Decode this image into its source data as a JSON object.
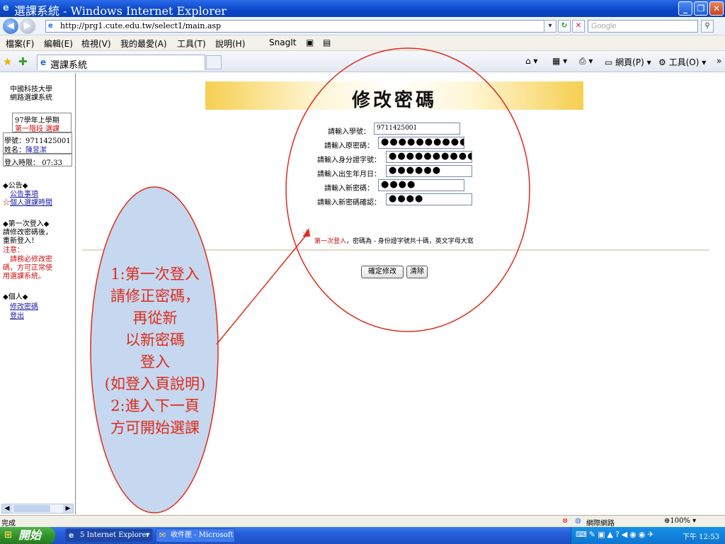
{
  "window": {
    "title": "選課系統 - Windows Internet Explorer",
    "minimize": "_",
    "maximize": "❐",
    "close": "✕"
  },
  "address": {
    "url": "http://prg1.cute.edu.tw/select1/main.asp",
    "search_placeholder": "Google"
  },
  "menu": {
    "items": [
      "檔案(F)",
      "編輯(E)",
      "檢視(V)",
      "我的最愛(A)",
      "工具(T)",
      "說明(H)"
    ],
    "snagit": "SnagIt"
  },
  "tabs": {
    "active_tab": "選課系統",
    "page_menu": "網頁(P)",
    "tools_menu": "工具(O)"
  },
  "sidebar": {
    "school": "中國科技大學",
    "system": "網路選課系統",
    "semester": "97學年上學期",
    "stage": "第一階段 選課",
    "student_id_label": "學號：",
    "student_id": "9711425001",
    "name_label": "姓名：",
    "name": "陳昱潔",
    "login_label": "登入時限：",
    "login_time": "07:33",
    "announce_header": "◆公告◆",
    "announce_link": "公告事項",
    "personal_time_star": "☆",
    "personal_time_link": "個人選課時間",
    "first_login_header": "◆第一次登入◆",
    "first_login_line1": "請修改密碼後，",
    "first_login_line2": "重新登入！",
    "note_label": "注意：",
    "note_line1": "請務必修改密",
    "note_line2": "碼，方可正常使",
    "note_line3": "用選課系統。",
    "personal_header": "◆個人◆",
    "change_pw_link": "修改密碼",
    "logout_link": "登出"
  },
  "form": {
    "heading": "修改密碼",
    "fields": [
      {
        "label": "請輸入學號：",
        "value": "9711425001"
      },
      {
        "label": "請輸入原密碼：",
        "value": "●●●●●●●●●●"
      },
      {
        "label": "請輸入身分證字號：",
        "value": "●●●●●●●●●●"
      },
      {
        "label": "請輸入出生年月日：",
        "value": "●●●●●●"
      },
      {
        "label": "請輸入新密碼：",
        "value": "●●●●"
      },
      {
        "label": "請輸入新密碼確認：",
        "value": "●●●●"
      }
    ],
    "notice_red": "第一次登入",
    "notice_rest": "，密碼為 - 身份證字號共十碼，英文字母大寫",
    "submit": "確定修改",
    "clear": "清除"
  },
  "annotation": {
    "lines": [
      "1:第一次登入",
      "請修正密碼，",
      "再從新",
      "以新密碼",
      "登入",
      "(如登入頁說明)",
      "2:進入下一頁",
      "方可開始選課"
    ],
    "color": "#e02a1a",
    "bubble_color": "#c5d8ef"
  },
  "status": {
    "text": "完成",
    "zone": "網際網路",
    "zoom": "100%"
  },
  "taskbar": {
    "start": "開始",
    "buttons": [
      "5 Internet Explorer",
      "收件匣 - Microsoft O..."
    ],
    "clock": "下午 12:53"
  }
}
